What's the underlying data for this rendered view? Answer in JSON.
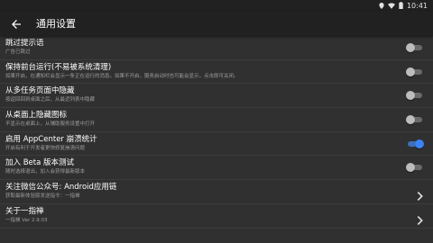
{
  "status": {
    "time": "10:41"
  },
  "app_bar": {
    "title": "通用设置"
  },
  "accent": "#3b82f6",
  "settings": [
    {
      "title": "跳过提示语",
      "subtitle": "广告已跳过",
      "type": "switch",
      "on": false
    },
    {
      "title": "保持前台运行(不易被系统清理)",
      "subtitle": "如果开启，在通知栏会显示一条正在运行的消息。如果不开启，服务启动时也可能会显示，点击即可关闭。",
      "type": "switch",
      "on": false
    },
    {
      "title": "从多任务页面中隐藏",
      "subtitle": "按返回回到桌面之后，从最近列表中隐藏",
      "type": "switch",
      "on": false
    },
    {
      "title": "从桌面上隐藏图标",
      "subtitle": "不显示在桌面上，从辅助服务设置中打开",
      "type": "switch",
      "on": false
    },
    {
      "title": "启用 AppCenter 崩溃统计",
      "subtitle": "开启有利于开发者更快修复崩溃问题",
      "type": "switch",
      "on": true
    },
    {
      "title": "加入 Beta 版本测试",
      "subtitle": "随时选择退出，加入会获得最新版本",
      "type": "switch",
      "on": false
    },
    {
      "title": "关注微信公众号: Android应用链",
      "subtitle": "获取最新体验版发送指令：一指禅",
      "type": "link"
    },
    {
      "title": "关于一指禅",
      "subtitle": "一指禅 Ver 2.9.03",
      "type": "link"
    }
  ]
}
